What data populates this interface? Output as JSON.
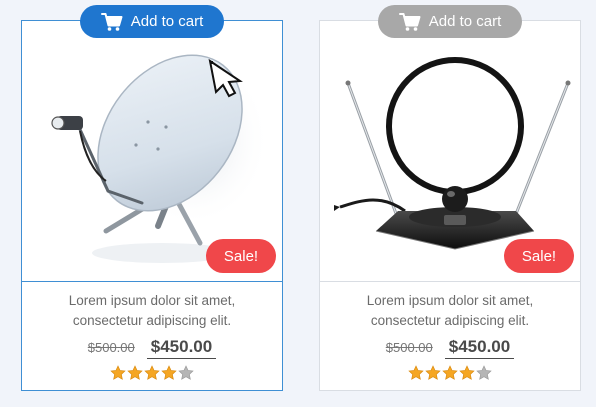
{
  "products": [
    {
      "cart_label": "Add to cart",
      "cart_state": "active",
      "cart_color": "#1f76cf",
      "image_icon": "satellite-dish-icon",
      "badge": "Sale!",
      "badge_color": "#f0474a",
      "description_line1": "Lorem ipsum dolor sit amet,",
      "description_line2": "consectetur adipiscing elit.",
      "old_price": "$500.00",
      "new_price": "$450.00",
      "rating": 4,
      "rating_max": 5
    },
    {
      "cart_label": "Add to cart",
      "cart_state": "inactive",
      "cart_color": "#a8a8a8",
      "image_icon": "indoor-antenna-icon",
      "badge": "Sale!",
      "badge_color": "#f0474a",
      "description_line1": "Lorem ipsum dolor sit amet,",
      "description_line2": "consectetur adipiscing elit.",
      "old_price": "$500.00",
      "new_price": "$450.00",
      "rating": 4,
      "rating_max": 5
    }
  ],
  "colors": {
    "active_border": "#3f8fd4",
    "star_filled": "#f5a623",
    "star_empty": "#b5b5b5"
  }
}
